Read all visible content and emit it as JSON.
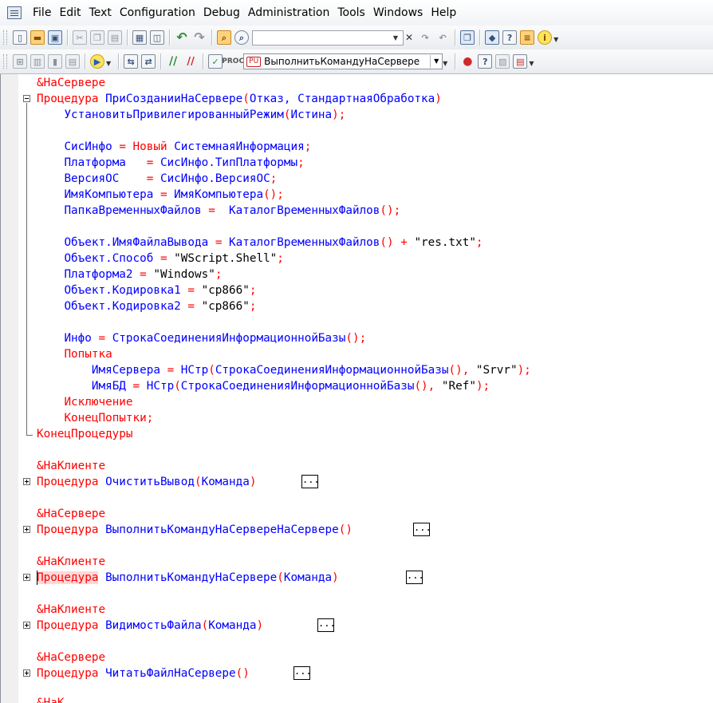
{
  "menu": [
    {
      "label": "File"
    },
    {
      "label": "Edit"
    },
    {
      "label": "Text"
    },
    {
      "label": "Configuration"
    },
    {
      "label": "Debug"
    },
    {
      "label": "Administration"
    },
    {
      "label": "Tools"
    },
    {
      "label": "Windows"
    },
    {
      "label": "Help"
    }
  ],
  "toolbar1": {
    "search_value": "",
    "icons": [
      "new-document-icon",
      "open-folder-icon",
      "save-icon",
      "cut-icon",
      "copy-icon",
      "paste-icon",
      "print-icon",
      "print-preview-icon",
      "undo-icon",
      "redo-icon",
      "find-in-files-icon",
      "find-icon",
      "find-next-icon",
      "find-previous-icon",
      "windows-icon",
      "syntax-assistant-icon",
      "search-help-icon",
      "bookmarks-icon",
      "info-icon"
    ]
  },
  "toolbar2": {
    "procedure_badge": "PU",
    "procedure_value": "ВыполнитьКомандуНаСервере"
  },
  "code": {
    "directive1": "&НаСервере",
    "proc1_kw": "Процедура",
    "proc1_name": "ПриСозданииНаСервере",
    "proc1_params": "Отказ, СтандартнаяОбработка",
    "line_priv_name": "УстановитьПривилегированныйРежим",
    "line_priv_arg": "Истина",
    "sysinfo_var": "СисИнфо",
    "kw_new": "Новый",
    "sysinfo_type": "СистемнаяИнформация",
    "platform_var": "Платформа",
    "platform_val": "СисИнфо.ТипПлатформы",
    "version_var": "ВерсияОС",
    "version_val": "СисИнфо.ВерсияОС",
    "pcname_var": "ИмяКомпьютера",
    "pcname_fn": "ИмяКомпьютера",
    "tmpdir_var": "ПапкаВременныхФайлов",
    "tmpdir_fn": "КаталогВременныхФайлов",
    "outfile_var": "Объект.ИмяФайлаВывода",
    "outfile_fn": "КаталогВременныхФайлов",
    "outfile_str": "\"res.txt\"",
    "method_var": "Объект.Способ",
    "method_str": "\"WScript.Shell\"",
    "platform2_var": "Платформа2",
    "platform2_str": "\"Windows\"",
    "enc1_var": "Объект.Кодировка1",
    "enc1_str": "\"cp866\"",
    "enc2_var": "Объект.Кодировка2",
    "enc2_str": "\"cp866\"",
    "info_var": "Инфо",
    "info_fn": "СтрокаСоединенияИнформационнойБазы",
    "kw_try": "Попытка",
    "server_var": "ИмяСервера",
    "nstr_fn": "НСтр",
    "conn_fn": "СтрокаСоединенияИнформационнойБазы",
    "server_str": "\"Srvr\"",
    "db_var": "ИмяБД",
    "db_str": "\"Ref\"",
    "kw_except": "Исключение",
    "kw_endtry": "КонецПопытки",
    "kw_endproc": "КонецПроцедуры",
    "directive_client": "&НаКлиенте",
    "directive_server": "&НаСервере",
    "proc_kw": "Процедура",
    "proc2_name": "ОчиститьВывод",
    "proc2_params": "Команда",
    "proc3_name": "ВыполнитьКомандуНаСервереНаСервере",
    "proc4_name": "ВыполнитьКомандуНаСервере",
    "proc4_params": "Команда",
    "proc5_name": "ВидимостьФайла",
    "proc5_params": "Команда",
    "proc6_name": "ЧитатьФайлНаСервере",
    "collapsed": "...",
    "partial_directive": "&НаК"
  },
  "colors": {
    "keyword": "#ff0000",
    "identifier": "#0000ff",
    "string": "#000000"
  }
}
